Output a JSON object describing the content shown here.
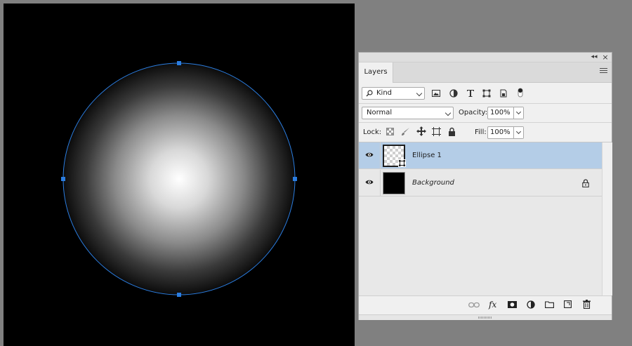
{
  "canvas": {
    "background_color": "#000000",
    "selection_color": "#2b7de0",
    "gradient": {
      "center_color": "#ffffff",
      "edge_color": "#000000"
    }
  },
  "panel": {
    "titlebar": {
      "collapse_label": "◂◂",
      "close_label": "×"
    },
    "tab": {
      "label": "Layers"
    },
    "menu_icon": "hamburger-menu-icon",
    "filter": {
      "kind_label": "Kind",
      "filter_icons": [
        "image-filter-icon",
        "adjustment-filter-icon",
        "type-filter-icon",
        "shape-filter-icon",
        "smart-object-filter-icon",
        "filter-toggle-icon"
      ]
    },
    "blend": {
      "mode": "Normal",
      "opacity_label": "Opacity:",
      "opacity_value": "100%"
    },
    "lock": {
      "lock_label": "Lock:",
      "lock_icons": [
        "lock-transparent-pixels-icon",
        "lock-image-pixels-icon",
        "lock-position-icon",
        "lock-artboard-icon",
        "lock-all-icon"
      ],
      "fill_label": "Fill:",
      "fill_value": "100%"
    },
    "layers": [
      {
        "name": "Ellipse 1",
        "visible": true,
        "selected": true,
        "thumbnail": "transparent-shape",
        "locked": false
      },
      {
        "name": "Background",
        "visible": true,
        "selected": false,
        "thumbnail": "black",
        "locked": true
      }
    ],
    "bottom_icons": [
      "link-layers-icon",
      "fx-icon",
      "add-mask-icon",
      "adjustment-layer-icon",
      "new-group-icon",
      "new-layer-icon",
      "delete-layer-icon"
    ],
    "fx_label": "fx",
    "selected_row_color": "#b4cde7"
  }
}
